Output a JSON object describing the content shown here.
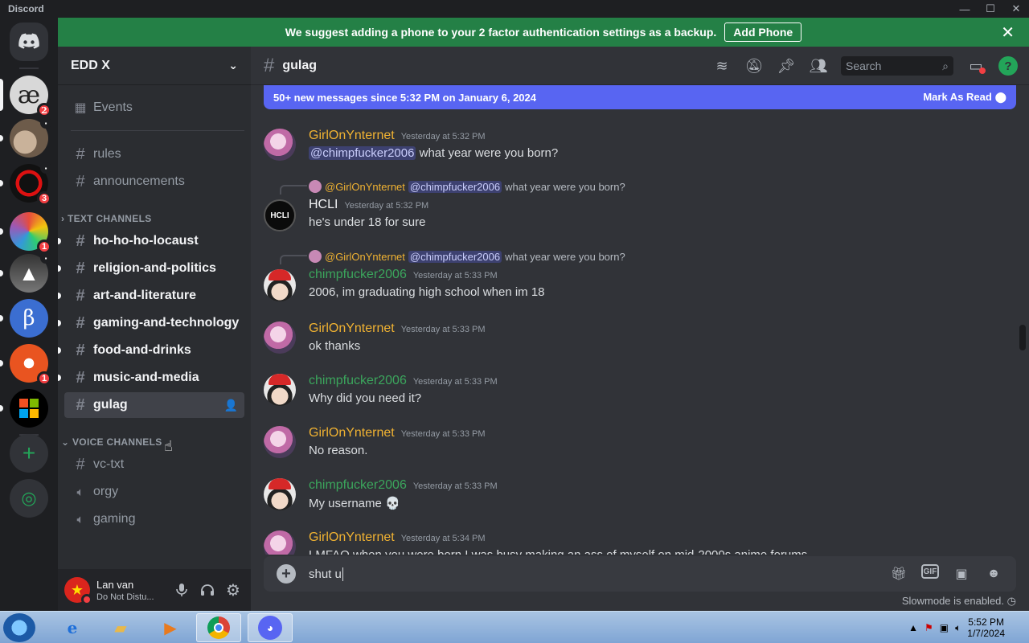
{
  "window": {
    "title": "Discord"
  },
  "banner": {
    "text": "We suggest adding a phone to your 2 factor authentication settings as a backup.",
    "button": "Add Phone"
  },
  "guilds": {
    "badges": [
      "2",
      "3",
      "1",
      "1"
    ]
  },
  "server": {
    "name": "EDD X"
  },
  "sidebar": {
    "events": "Events",
    "top_channels": [
      "rules",
      "announcements"
    ],
    "text_category": "TEXT CHANNELS",
    "text_channels": [
      "ho-ho-ho-locaust",
      "religion-and-politics",
      "art-and-literature",
      "gaming-and-technology",
      "food-and-drinks",
      "music-and-media",
      "gulag"
    ],
    "voice_category": "VOICE CHANNELS",
    "voice_channels": [
      "vc-txt",
      "orgy",
      "gaming"
    ]
  },
  "user": {
    "name": "Lan van",
    "status": "Do Not Distu..."
  },
  "channel": {
    "name": "gulag",
    "search_placeholder": "Search"
  },
  "newbar": {
    "text": "50+ new messages since 5:32 PM on January 6, 2024",
    "action": "Mark As Read"
  },
  "messages": [
    {
      "author": "GirlOnYnternet",
      "time": "Yesterday at 5:32 PM",
      "mention": "@chimpfucker2006",
      "text": " what year were you born?"
    },
    {
      "reply_author": "@GirlOnYnternet",
      "reply_mention": "@chimpfucker2006",
      "reply_text": "what year were you born?",
      "author": "HCLI",
      "time": "Yesterday at 5:32 PM",
      "text": "he's under 18 for sure"
    },
    {
      "reply_author": "@GirlOnYnternet",
      "reply_mention": "@chimpfucker2006",
      "reply_text": "what year were you born?",
      "author": "chimpfucker2006",
      "time": "Yesterday at 5:33 PM",
      "text": "2006, im graduating high school when im 18"
    },
    {
      "author": "GirlOnYnternet",
      "time": "Yesterday at 5:33 PM",
      "text": "ok thanks"
    },
    {
      "author": "chimpfucker2006",
      "time": "Yesterday at 5:33 PM",
      "text": "Why did you need it?"
    },
    {
      "author": "GirlOnYnternet",
      "time": "Yesterday at 5:33 PM",
      "text": "No reason."
    },
    {
      "author": "chimpfucker2006",
      "time": "Yesterday at 5:33 PM",
      "text": "My username 💀"
    },
    {
      "author": "GirlOnYnternet",
      "time": "Yesterday at 5:34 PM",
      "text": "LMFAO when you were born I was busy making an ass of myself on mid-2000s anime forums"
    }
  ],
  "composer": {
    "value": "shut u",
    "slowmode": "Slowmode is enabled."
  },
  "colors": {
    "girl": "#f0b232",
    "chimp": "#3ba55c",
    "hcli": "#f2f3f5",
    "accent": "#5865f2",
    "banner": "#248046"
  },
  "taskbar": {
    "time": "5:52 PM",
    "date": "1/7/2024"
  }
}
